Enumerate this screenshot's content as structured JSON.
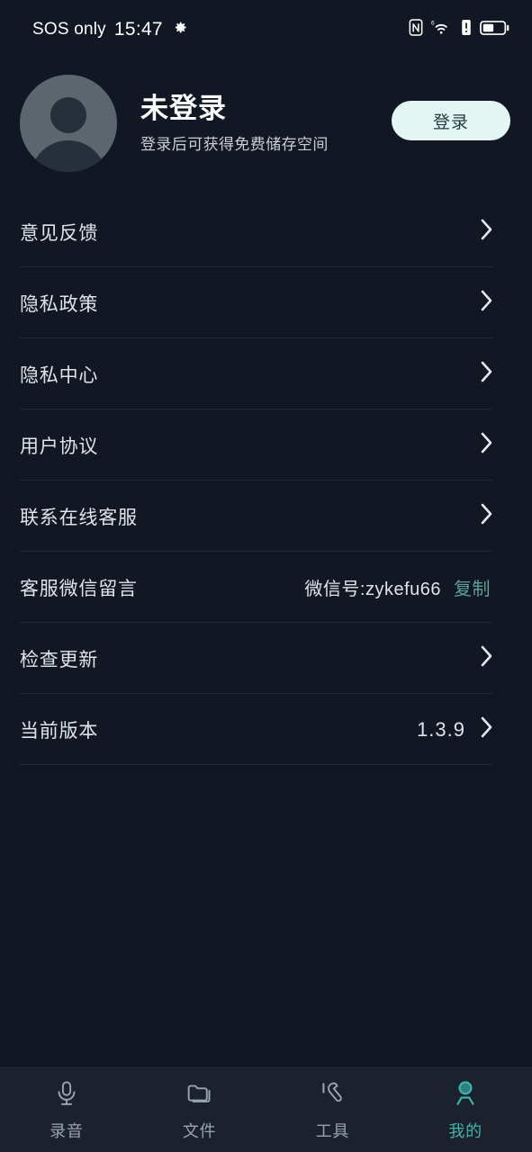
{
  "statusbar": {
    "carrier": "SOS only",
    "time": "15:47",
    "icons": [
      "gear-icon",
      "nfc-icon",
      "wifi-6-icon",
      "signal-alert-icon",
      "battery-icon"
    ]
  },
  "profile": {
    "avatar_icon": "default-user-avatar",
    "name": "未登录",
    "subtitle": "登录后可获得免费储存空间",
    "login_label": "登录"
  },
  "menu": {
    "items": [
      {
        "label": "意见反馈",
        "value": "",
        "chevron": true,
        "copy": ""
      },
      {
        "label": "隐私政策",
        "value": "",
        "chevron": true,
        "copy": ""
      },
      {
        "label": "隐私中心",
        "value": "",
        "chevron": true,
        "copy": ""
      },
      {
        "label": "用户协议",
        "value": "",
        "chevron": true,
        "copy": ""
      },
      {
        "label": "联系在线客服",
        "value": "",
        "chevron": true,
        "copy": ""
      },
      {
        "label": "客服微信留言",
        "value": "微信号:zykefu66",
        "chevron": false,
        "copy": "复制"
      },
      {
        "label": "检查更新",
        "value": "",
        "chevron": true,
        "copy": ""
      },
      {
        "label": "当前版本",
        "value": "1.3.9",
        "chevron": true,
        "copy": ""
      }
    ]
  },
  "tabbar": {
    "items": [
      {
        "label": "录音",
        "icon": "microphone-icon",
        "active": false
      },
      {
        "label": "文件",
        "icon": "folder-icon",
        "active": false
      },
      {
        "label": "工具",
        "icon": "wrench-icon",
        "active": false
      },
      {
        "label": "我的",
        "icon": "person-icon",
        "active": true
      }
    ]
  },
  "colors": {
    "background": "#111823",
    "tabbar_background": "#1b222d",
    "accent": "#3fb3ad",
    "copy_link": "#5fa096",
    "login_button_bg": "#e4f6f4",
    "login_button_text": "#1d3c3c",
    "divider": "#222b37",
    "primary_text": "#ffffff",
    "secondary_text": "#dfe4ea",
    "inactive_tab": "#9aa4b1"
  }
}
